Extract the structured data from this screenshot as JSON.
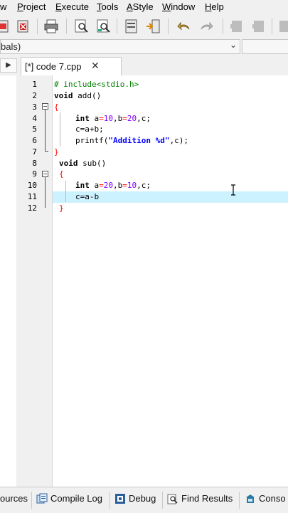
{
  "menu": {
    "items": [
      {
        "label": "w",
        "ul": ""
      },
      {
        "label": "Project",
        "ul": "P"
      },
      {
        "label": "Execute",
        "ul": "E"
      },
      {
        "label": "Tools",
        "ul": "T"
      },
      {
        "label": "AStyle",
        "ul": "A"
      },
      {
        "label": "Window",
        "ul": "W"
      },
      {
        "label": "Help",
        "ul": "H"
      }
    ]
  },
  "toolbar": {
    "icons": [
      "compile-run-icon",
      "close-file-icon",
      "print-icon",
      "search-icon",
      "replace-icon",
      "toggle-panel-icon",
      "goto-icon",
      "undo-icon",
      "redo-icon",
      "bookmark-icon",
      "bookmark-next-icon",
      "stop-icon"
    ]
  },
  "class_browser": {
    "value": "bals)"
  },
  "tabs": {
    "active_file": "[*] code 7.cpp",
    "close_glyph": "✕",
    "left_arrow": "▶"
  },
  "editor": {
    "line_numbers": [
      "1",
      "2",
      "3",
      "4",
      "5",
      "6",
      "7",
      "8",
      "9",
      "10",
      "11",
      "12"
    ],
    "code": {
      "l1": "# include<stdio.h>",
      "l2_kw": "void",
      "l2_rest": " add()",
      "l3": "{",
      "l4_kw": "int",
      "l4_a": " a",
      "l4_eq1": "=",
      "l4_n1": "10",
      "l4_b": ",b",
      "l4_eq2": "=",
      "l4_n2": "20",
      "l4_c": ",c;",
      "l5": "c=a+b;",
      "l6_fn": "printf(",
      "l6_str": "\"Addition %d\"",
      "l6_end": ",c);",
      "l7": "}",
      "l8_kw": "void",
      "l8_rest": " sub()",
      "l9": "{",
      "l10_kw": "int",
      "l10_a": " a",
      "l10_eq1": "=",
      "l10_n1": "20",
      "l10_b": ",b",
      "l10_eq2": "=",
      "l10_n2": "10",
      "l10_c": ",c;",
      "l11": "c=a-b",
      "l12": "}"
    }
  },
  "bottom_tabs": [
    {
      "label": "ources",
      "icon": "resources-icon"
    },
    {
      "label": "Compile Log",
      "icon": "compile-log-icon"
    },
    {
      "label": "Debug",
      "icon": "debug-icon"
    },
    {
      "label": "Find Results",
      "icon": "find-results-icon"
    },
    {
      "label": "Conso",
      "icon": "console-icon"
    }
  ],
  "colors": {
    "keyword": "#000000",
    "preprocessor": "#008000",
    "string": "#0000ff",
    "number": "#8000ff",
    "brace": "#ff0000",
    "current_line": "#ccf2ff"
  }
}
